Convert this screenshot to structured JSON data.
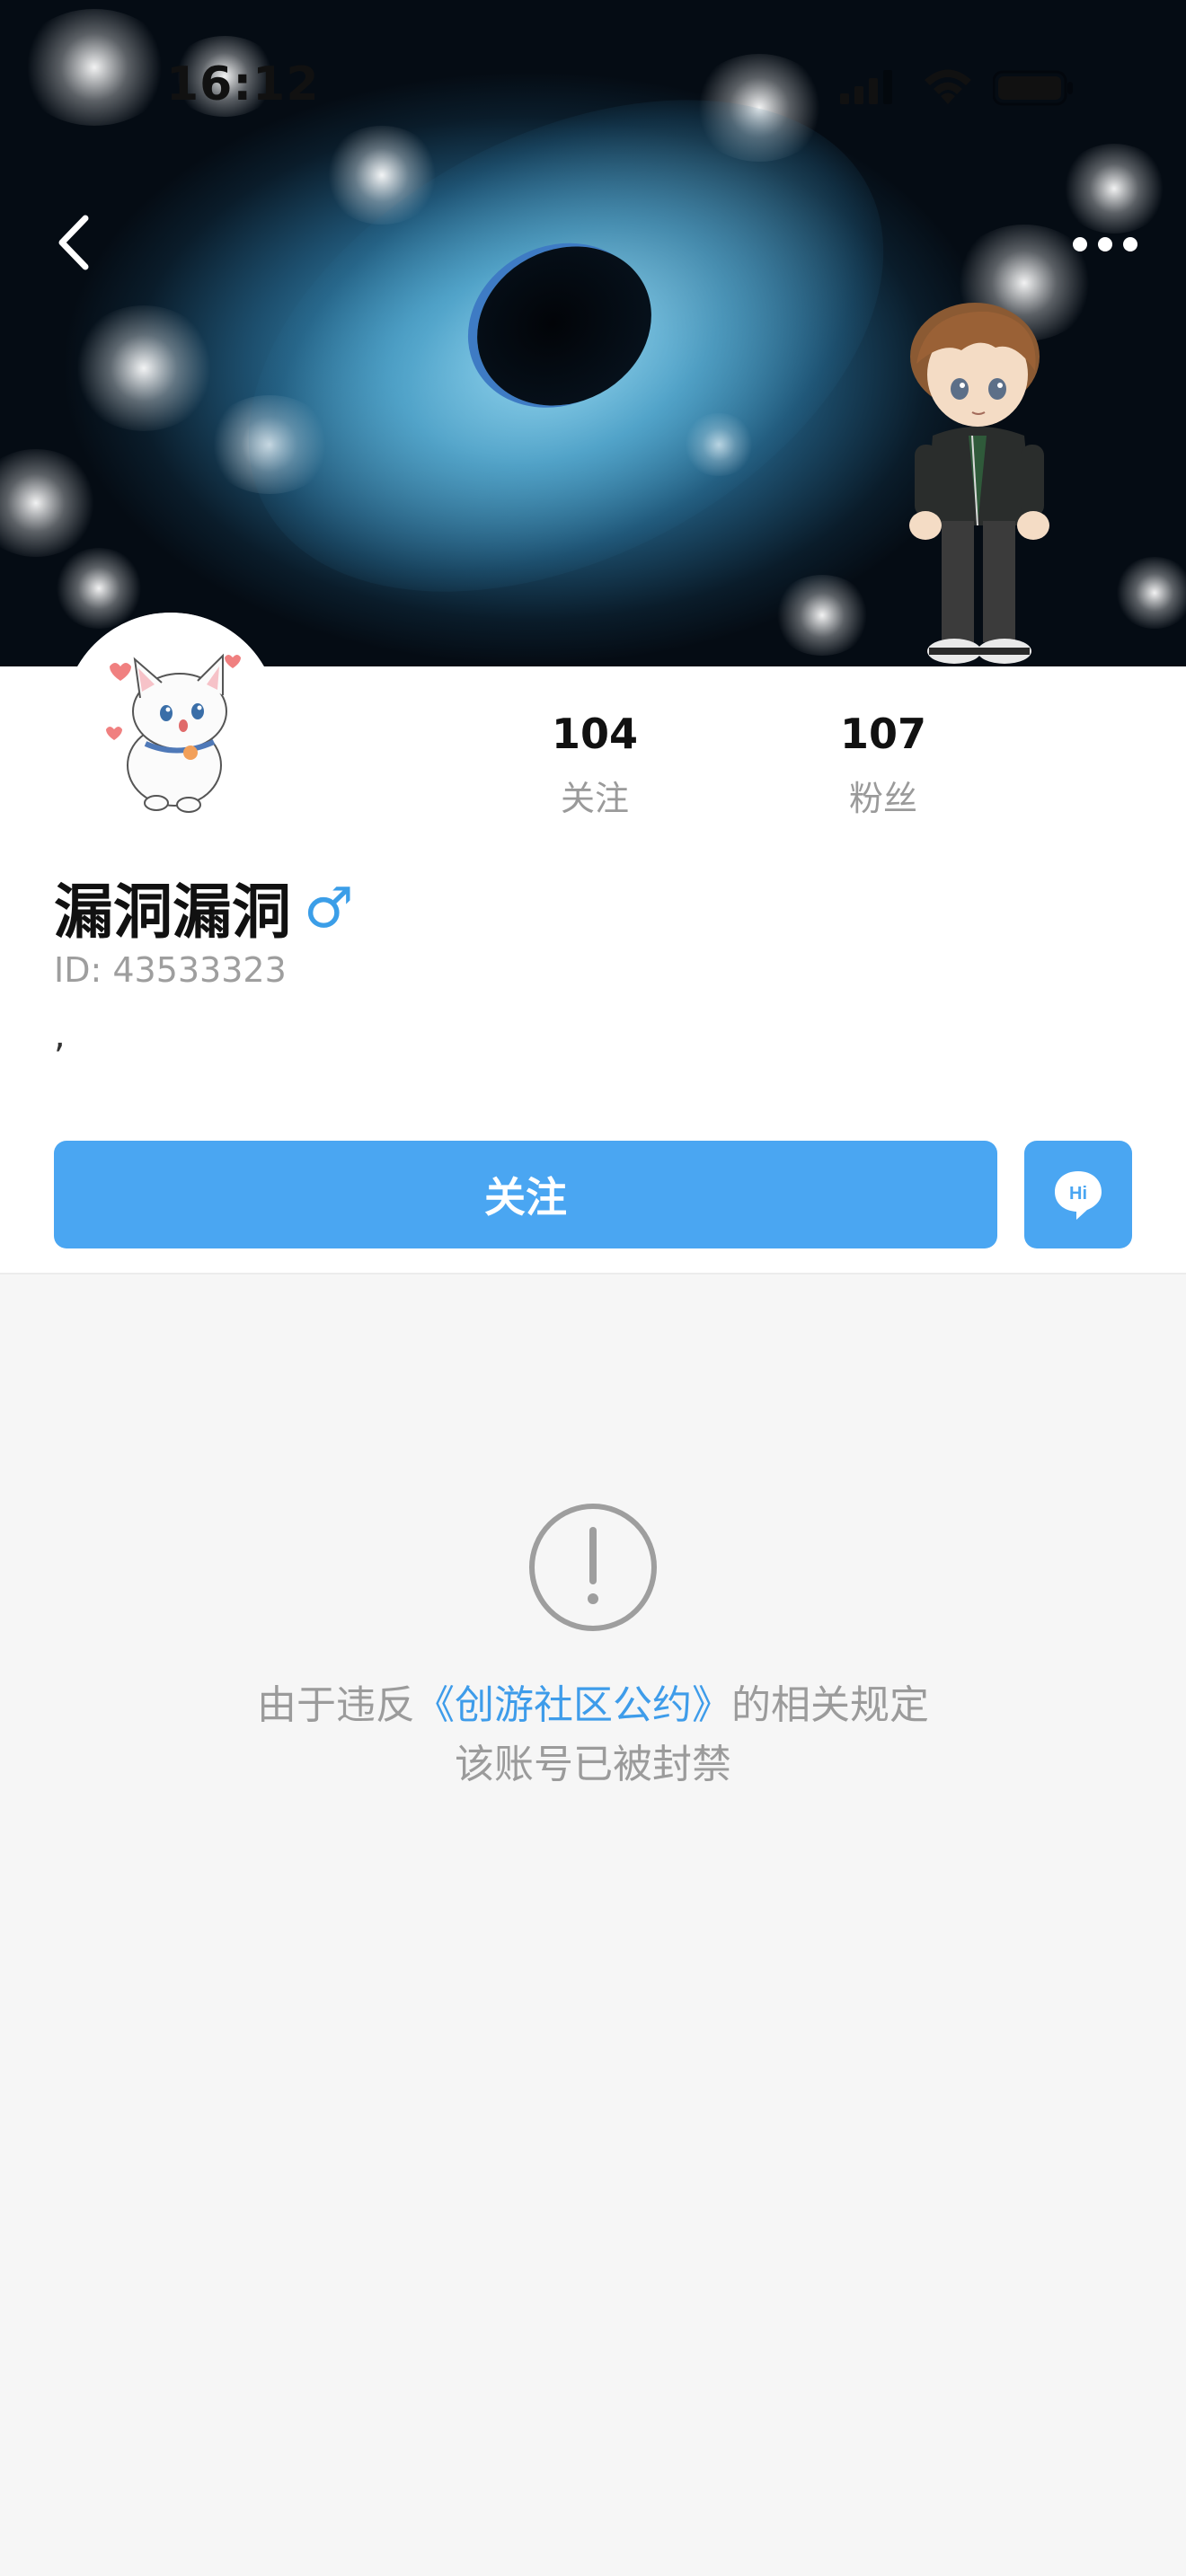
{
  "status_bar": {
    "time": "16:12",
    "signal_icon": "cellular-signal-icon",
    "wifi_icon": "wifi-icon",
    "battery_icon": "battery-icon"
  },
  "header": {
    "back_icon": "chevron-left-icon",
    "more_icon": "more-dots-icon",
    "banner_image": "black-hole-galaxy-banner-with-cartoon-character"
  },
  "profile": {
    "avatar": "white-cat-cartoon-avatar",
    "stats": [
      {
        "value": "104",
        "label": "关注"
      },
      {
        "value": "107",
        "label": "粉丝"
      }
    ],
    "name": "漏洞漏洞",
    "gender_symbol": "♂",
    "id_text": "ID: 43533323",
    "bio": ","
  },
  "actions": {
    "follow_label": "关注",
    "message_icon": "hi-chat-bubble-icon",
    "message_icon_text": "Hi"
  },
  "notice": {
    "icon": "exclamation-circle-icon",
    "line1_prefix": "由于违反",
    "line1_link": "《创游社区公约》",
    "line1_suffix": "的相关规定",
    "line2": "该账号已被封禁"
  },
  "colors": {
    "accent": "#4aa6f2",
    "link": "#3e9cea",
    "gender": "#3b9ee8",
    "muted_text": "#9b9b9b",
    "page_bg": "#f6f6f6"
  }
}
